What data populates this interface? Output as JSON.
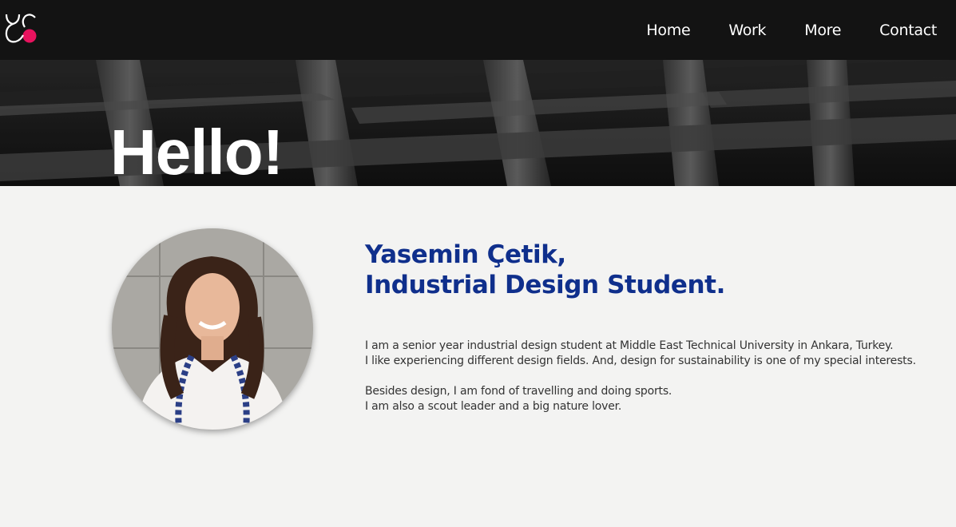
{
  "brand": {
    "logo_icon": "yc-monogram-logo-icon",
    "accent": "#e8135e"
  },
  "nav": {
    "items": [
      {
        "label": "Home"
      },
      {
        "label": "Work"
      },
      {
        "label": "More"
      },
      {
        "label": "Contact"
      }
    ]
  },
  "hero": {
    "title": "Hello!"
  },
  "profile": {
    "name_line": "Yasemin Çetik,",
    "role_line": "Industrial Design Student.",
    "bio": [
      "I am a senior year industrial design student at Middle East Technical University in Ankara, Turkey.",
      "I like experiencing different design fields. And, design for sustainability is one of my special interests.",
      "Besides design, I am fond of travelling and doing sports.",
      "I am also a scout leader and a big nature lover."
    ]
  },
  "colors": {
    "heading": "#0f2f8c",
    "nav_bg": "#131313",
    "body_text": "#333333"
  }
}
